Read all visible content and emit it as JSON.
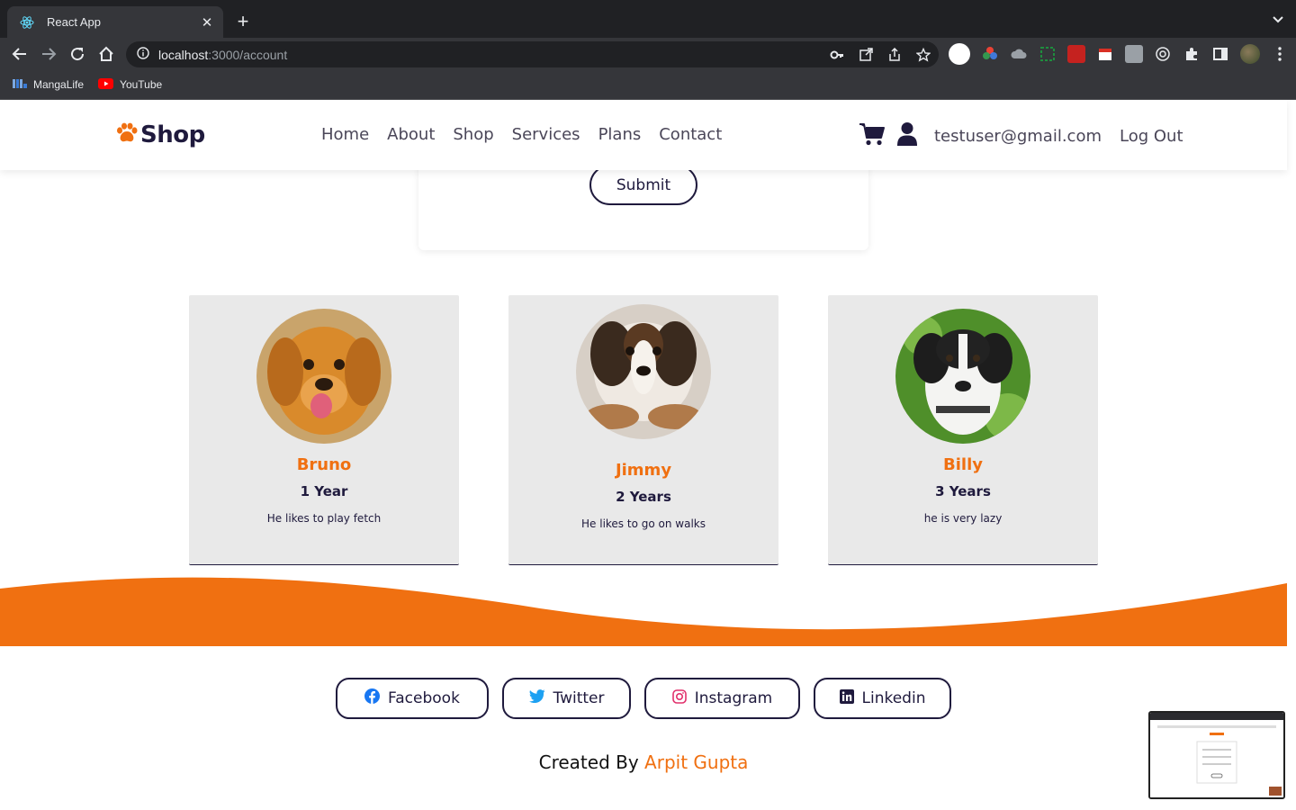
{
  "browser": {
    "tab_title": "React App",
    "tab_close": "✕",
    "new_tab": "+",
    "url_host": "localhost",
    "url_path": ":3000/account",
    "bookmarks": [
      {
        "label": "MangaLife",
        "icon": "mangalife-icon"
      },
      {
        "label": "YouTube",
        "icon": "youtube-icon"
      }
    ]
  },
  "navbar": {
    "logo_text": "Shop",
    "menu": [
      "Home",
      "About",
      "Shop",
      "Services",
      "Plans",
      "Contact"
    ],
    "user_email": "testuser@gmail.com",
    "logout_label": "Log Out"
  },
  "form": {
    "submit_label": "Submit"
  },
  "pets": [
    {
      "name": "Bruno",
      "age": "1 Year",
      "description": "He likes to play fetch"
    },
    {
      "name": "Jimmy",
      "age": "2 Years",
      "description": "He likes to go on walks"
    },
    {
      "name": "Billy",
      "age": "3 Years",
      "description": "he is very lazy"
    }
  ],
  "footer": {
    "socials": [
      "Facebook",
      "Twitter",
      "Instagram",
      "Linkedin"
    ],
    "credit_prefix": "Created By",
    "credit_name": "Arpit Gupta"
  },
  "colors": {
    "accent": "#f07011",
    "navy": "#1f1a3d",
    "card_bg": "#e9e9e9"
  }
}
